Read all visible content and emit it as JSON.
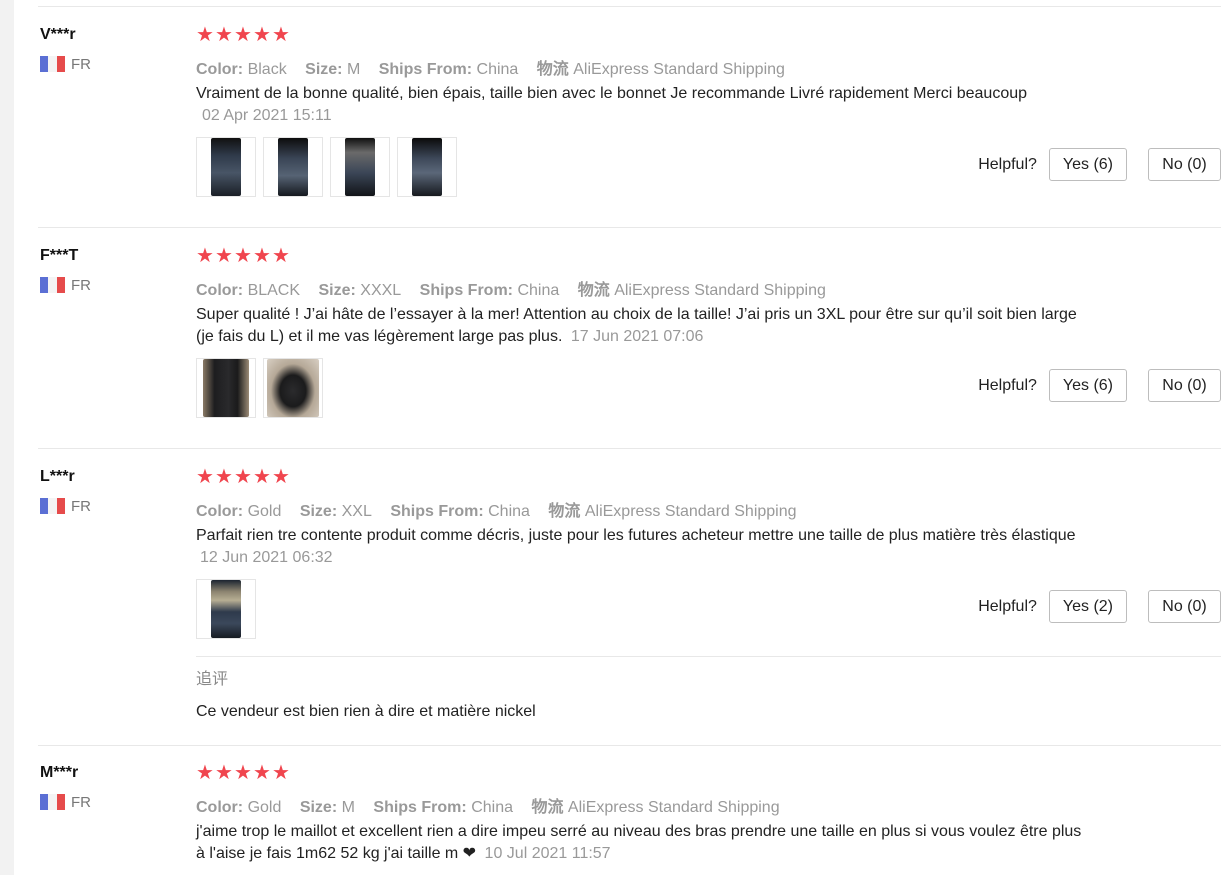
{
  "labels": {
    "color": "Color:",
    "size": "Size:",
    "ships_from": "Ships From:",
    "logistics": "物流",
    "helpful": "Helpful?"
  },
  "stars_rating": 5,
  "reviews": [
    {
      "user": "V***r",
      "country": "FR",
      "color": "Black",
      "size": "M",
      "ships_from": "China",
      "shipping": "AliExpress Standard Shipping",
      "text": "Vraiment de la bonne qualité, bien épais, taille bien avec le bonnet Je recommande Livré rapidement Merci beaucoup",
      "date": "02 Apr 2021 15:11",
      "yes": "Yes (6)",
      "no": "No (0)"
    },
    {
      "user": "F***T",
      "country": "FR",
      "color": "BLACK",
      "size": "XXXL",
      "ships_from": "China",
      "shipping": "AliExpress Standard Shipping",
      "text": "Super qualité ! J’ai hâte de l’essayer à la mer! Attention au choix de la taille! J’ai pris un 3XL pour être sur qu’il soit bien large (je fais du L) et il me vas légèrement large pas plus.",
      "date": "17 Jun 2021 07:06",
      "yes": "Yes (6)",
      "no": "No (0)"
    },
    {
      "user": "L***r",
      "country": "FR",
      "color": "Gold",
      "size": "XXL",
      "ships_from": "China",
      "shipping": "AliExpress Standard Shipping",
      "text": "Parfait rien tre contente produit comme décris, juste pour les futures acheteur mettre une taille de plus matière très élastique",
      "date": "12 Jun 2021 06:32",
      "yes": "Yes (2)",
      "no": "No (0)",
      "followup_title": "追评",
      "followup_text": "Ce vendeur est bien rien à dire et matière nickel"
    },
    {
      "user": "M***r",
      "country": "FR",
      "color": "Gold",
      "size": "M",
      "ships_from": "China",
      "shipping": "AliExpress Standard Shipping",
      "text": "j'aime trop le maillot et excellent rien a dire impeu serré au niveau des bras prendre une taille en plus si vous voulez être plus à l'aise je fais 1m62 52 kg j'ai taille m ❤",
      "date": "10 Jul 2021 11:57"
    }
  ]
}
